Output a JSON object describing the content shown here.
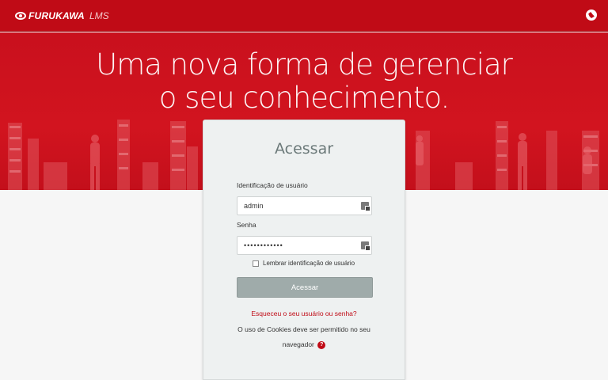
{
  "header": {
    "brand": "FURUKAWA",
    "product": "LMS",
    "language_icon": "globe-icon"
  },
  "hero": {
    "line1": "Uma nova forma de gerenciar",
    "line2": "o seu conhecimento."
  },
  "login": {
    "title": "Acessar",
    "username_label": "Identificação de usuário",
    "username_value": "admin",
    "password_label": "Senha",
    "password_value": "••••••••••••",
    "remember_label": "Lembrar identificação de usuário",
    "remember_checked": false,
    "submit_label": "Acessar",
    "forgot_link": "Esqueceu o seu usuário ou senha?",
    "cookie_notice_line1": "O uso de Cookies deve ser permitido no seu",
    "cookie_notice_line2": "navegador"
  },
  "colors": {
    "brand_red": "#c00b16",
    "button_gray": "#9fabaa",
    "card_bg": "#eef1f1"
  }
}
